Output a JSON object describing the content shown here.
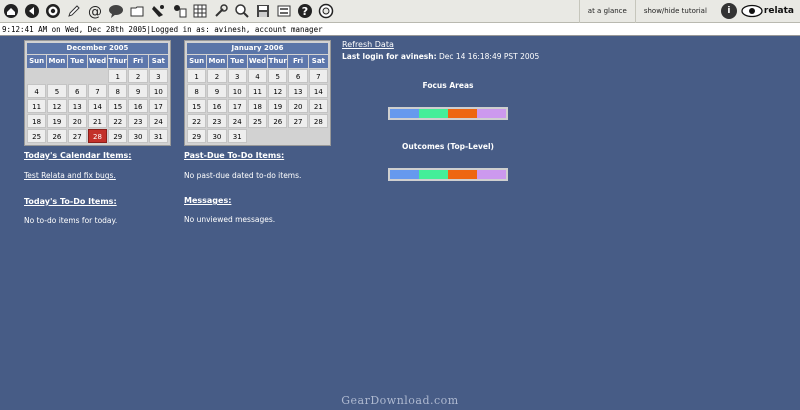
{
  "toolbar": {
    "icons": [
      "home-icon",
      "navigate-icon",
      "target-icon",
      "pencil-icon",
      "at-email-icon",
      "chat-bubble-icon",
      "folder-icon",
      "alarm-icon",
      "contacts-icon",
      "calendar-grid-icon",
      "tools-icon",
      "search-icon",
      "save-icon",
      "preferences-icon",
      "help-icon",
      "lifesaver-icon"
    ],
    "at_a_glance": "at a glance",
    "show_hide_tutorial": "show/hide tutorial",
    "info_label": "i",
    "logo_text": "relata"
  },
  "status": {
    "time": "9:12:41 AM on Wed, Dec 28th 2005",
    "separator": "|",
    "logged_in": "Logged in as: avinesh, account manager"
  },
  "calendars": [
    {
      "title": "December 2005",
      "headers": [
        "Sun",
        "Mon",
        "Tue",
        "Wed",
        "Thur",
        "Fri",
        "Sat"
      ],
      "weeks": [
        [
          "",
          "",
          "",
          "",
          "1",
          "2",
          "3"
        ],
        [
          "4",
          "5",
          "6",
          "7",
          "8",
          "9",
          "10"
        ],
        [
          "11",
          "12",
          "13",
          "14",
          "15",
          "16",
          "17"
        ],
        [
          "18",
          "19",
          "20",
          "21",
          "22",
          "23",
          "24"
        ],
        [
          "25",
          "26",
          "27",
          "28",
          "29",
          "30",
          "31"
        ]
      ],
      "today": "28"
    },
    {
      "title": "January 2006",
      "headers": [
        "Sun",
        "Mon",
        "Tue",
        "Wed",
        "Thur",
        "Fri",
        "Sat"
      ],
      "weeks": [
        [
          "1",
          "2",
          "3",
          "4",
          "5",
          "6",
          "7"
        ],
        [
          "8",
          "9",
          "10",
          "11",
          "12",
          "13",
          "14"
        ],
        [
          "15",
          "16",
          "17",
          "18",
          "19",
          "20",
          "21"
        ],
        [
          "22",
          "23",
          "24",
          "25",
          "26",
          "27",
          "28"
        ],
        [
          "29",
          "30",
          "31",
          "",
          "",
          "",
          ""
        ]
      ],
      "today": ""
    }
  ],
  "sections": {
    "calendar_items_title": "Today's Calendar Items:",
    "calendar_items_link": "Test Relata and fix bugs.",
    "past_due_title": "Past-Due To-Do Items:",
    "past_due_text": "No past-due dated to-do items.",
    "todo_title": "Today's To-Do Items:",
    "todo_text": "No to-do items for today.",
    "messages_title": "Messages:",
    "messages_text": "No unviewed messages."
  },
  "info": {
    "refresh": "Refresh Data",
    "last_login_label": "Last login for avinesh:",
    "last_login_value": "Dec 14 16:18:49 PST 2005"
  },
  "focus": {
    "title": "Focus Areas",
    "colors": [
      "#6699ee",
      "#44ee99",
      "#ee6611",
      "#cc99ee"
    ]
  },
  "outcomes": {
    "title": "Outcomes (Top-Level)",
    "colors": [
      "#6699ee",
      "#44ee99",
      "#ee6611",
      "#cc99ee"
    ]
  },
  "watermark": "GearDownload.com"
}
